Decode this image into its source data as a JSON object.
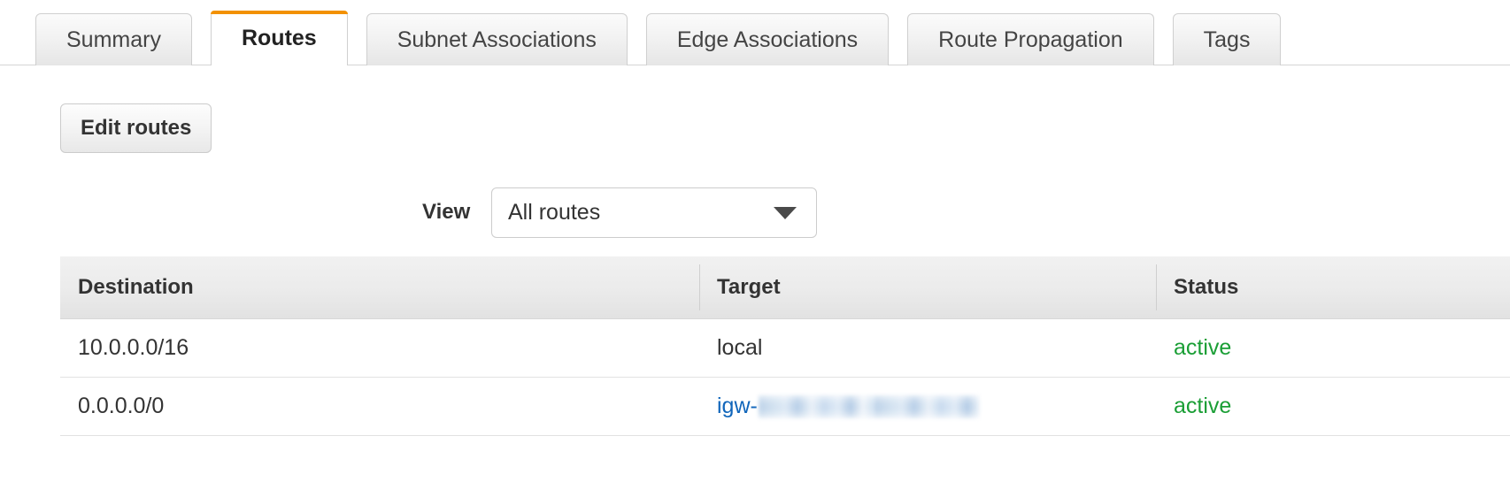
{
  "tabs": [
    {
      "label": "Summary",
      "active": false
    },
    {
      "label": "Routes",
      "active": true
    },
    {
      "label": "Subnet Associations",
      "active": false
    },
    {
      "label": "Edge Associations",
      "active": false
    },
    {
      "label": "Route Propagation",
      "active": false
    },
    {
      "label": "Tags",
      "active": false
    }
  ],
  "toolbar": {
    "edit_routes_label": "Edit routes"
  },
  "filter": {
    "view_label": "View",
    "view_selected": "All routes"
  },
  "table": {
    "columns": [
      "Destination",
      "Target",
      "Status"
    ],
    "rows": [
      {
        "destination": "10.0.0.0/16",
        "target": "local",
        "target_is_link": false,
        "target_redacted": false,
        "status": "active"
      },
      {
        "destination": "0.0.0.0/0",
        "target": "igw-",
        "target_is_link": true,
        "target_redacted": true,
        "status": "active"
      }
    ]
  },
  "colors": {
    "accent_orange": "#f29100",
    "status_active_green": "#1a9e35",
    "link_blue": "#1166bb"
  }
}
